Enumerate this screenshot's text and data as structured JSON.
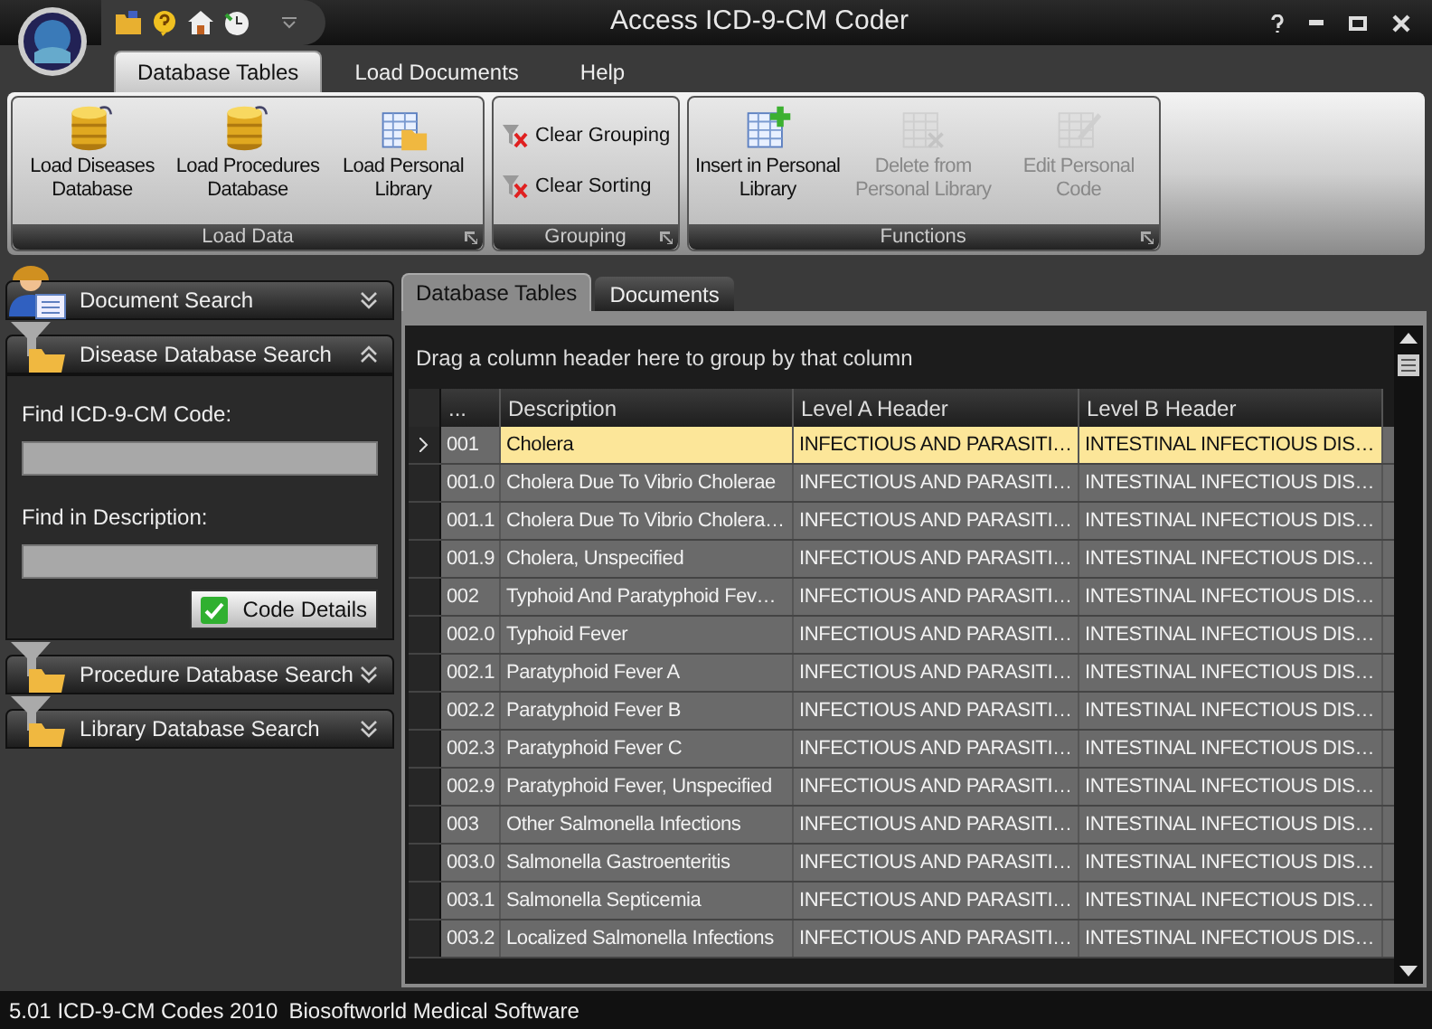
{
  "window": {
    "title": "Access ICD-9-CM Coder"
  },
  "ribbon_tabs": [
    {
      "label": "Database Tables",
      "selected": true
    },
    {
      "label": "Load Documents",
      "selected": false
    },
    {
      "label": "Help",
      "selected": false
    }
  ],
  "ribbon_groups": [
    {
      "title": "Load Data",
      "kind": "large",
      "buttons": [
        {
          "label": "Load Diseases Database",
          "disabled": false
        },
        {
          "label": "Load Procedures Database",
          "disabled": false
        },
        {
          "label": "Load Personal Library",
          "disabled": false
        }
      ]
    },
    {
      "title": "Grouping",
      "kind": "small",
      "buttons": [
        {
          "label": "Clear Grouping",
          "disabled": false
        },
        {
          "label": "Clear Sorting",
          "disabled": false
        }
      ]
    },
    {
      "title": "Functions",
      "kind": "large",
      "buttons": [
        {
          "label": "Insert in Personal Library",
          "disabled": false
        },
        {
          "label": "Delete from Personal Library",
          "disabled": true
        },
        {
          "label": "Edit Personal Code",
          "disabled": true
        }
      ]
    }
  ],
  "sidebar": {
    "sections": [
      {
        "title": "Document Search",
        "expanded": false
      },
      {
        "title": "Disease Database Search",
        "expanded": true,
        "fields": [
          {
            "label": "Find ICD-9-CM Code:"
          },
          {
            "label": "Find in Description:"
          }
        ],
        "button": "Code Details"
      },
      {
        "title": "Procedure Database Search",
        "expanded": false
      },
      {
        "title": "Library Database Search",
        "expanded": false
      }
    ]
  },
  "doc_tabs": [
    {
      "label": "Database Tables",
      "selected": true
    },
    {
      "label": "Documents",
      "selected": false
    }
  ],
  "table": {
    "group_hint": "Drag a column header here to group by that column",
    "columns": [
      "...",
      "Description",
      "Level A Header",
      "Level B Header"
    ],
    "rows": [
      {
        "cells": [
          "001",
          "Cholera",
          "INFECTIOUS AND PARASITI…",
          "INTESTINAL INFECTIOUS DIS…"
        ],
        "selected": true
      },
      {
        "cells": [
          "001.0",
          "Cholera Due To Vibrio Cholerae",
          "INFECTIOUS AND PARASITI…",
          "INTESTINAL INFECTIOUS DIS…"
        ],
        "selected": false
      },
      {
        "cells": [
          "001.1",
          "Cholera Due To Vibrio Cholera…",
          "INFECTIOUS AND PARASITI…",
          "INTESTINAL INFECTIOUS DIS…"
        ],
        "selected": false
      },
      {
        "cells": [
          "001.9",
          "Cholera, Unspecified",
          "INFECTIOUS AND PARASITI…",
          "INTESTINAL INFECTIOUS DIS…"
        ],
        "selected": false
      },
      {
        "cells": [
          "002",
          "Typhoid And Paratyphoid Fev…",
          "INFECTIOUS AND PARASITI…",
          "INTESTINAL INFECTIOUS DIS…"
        ],
        "selected": false
      },
      {
        "cells": [
          "002.0",
          "Typhoid Fever",
          "INFECTIOUS AND PARASITI…",
          "INTESTINAL INFECTIOUS DIS…"
        ],
        "selected": false
      },
      {
        "cells": [
          "002.1",
          "Paratyphoid Fever A",
          "INFECTIOUS AND PARASITI…",
          "INTESTINAL INFECTIOUS DIS…"
        ],
        "selected": false
      },
      {
        "cells": [
          "002.2",
          "Paratyphoid Fever B",
          "INFECTIOUS AND PARASITI…",
          "INTESTINAL INFECTIOUS DIS…"
        ],
        "selected": false
      },
      {
        "cells": [
          "002.3",
          "Paratyphoid Fever C",
          "INFECTIOUS AND PARASITI…",
          "INTESTINAL INFECTIOUS DIS…"
        ],
        "selected": false
      },
      {
        "cells": [
          "002.9",
          "Paratyphoid Fever, Unspecified",
          "INFECTIOUS AND PARASITI…",
          "INTESTINAL INFECTIOUS DIS…"
        ],
        "selected": false
      },
      {
        "cells": [
          "003",
          "Other Salmonella Infections",
          "INFECTIOUS AND PARASITI…",
          "INTESTINAL INFECTIOUS DIS…"
        ],
        "selected": false
      },
      {
        "cells": [
          "003.0",
          "Salmonella Gastroenteritis",
          "INFECTIOUS AND PARASITI…",
          "INTESTINAL INFECTIOUS DIS…"
        ],
        "selected": false
      },
      {
        "cells": [
          "003.1",
          "Salmonella Septicemia",
          "INFECTIOUS AND PARASITI…",
          "INTESTINAL INFECTIOUS DIS…"
        ],
        "selected": false
      },
      {
        "cells": [
          "003.2",
          "Localized Salmonella Infections",
          "INFECTIOUS AND PARASITI…",
          "INTESTINAL INFECTIOUS DIS…"
        ],
        "selected": false
      }
    ]
  },
  "status_bar": [
    "5.01 ICD-9-CM Codes 2010",
    "Biosoftworld Medical Software"
  ]
}
